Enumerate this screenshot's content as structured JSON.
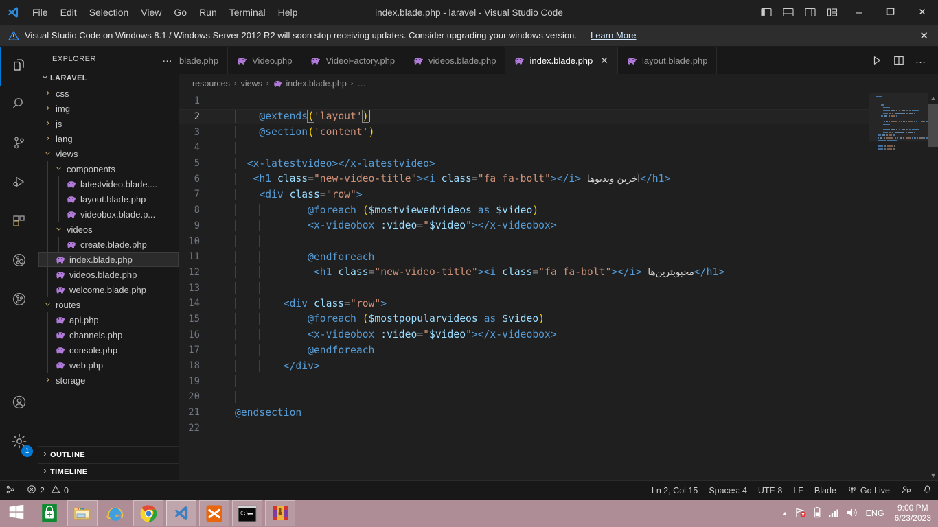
{
  "titlebar": {
    "logo_icon": "vscode-logo",
    "menus": [
      "File",
      "Edit",
      "Selection",
      "View",
      "Go",
      "Run",
      "Terminal",
      "Help"
    ],
    "window_title": "index.blade.php - laravel - Visual Studio Code",
    "layout_buttons": [
      {
        "name": "toggle-primary-sidebar",
        "icon": "panel-left-icon"
      },
      {
        "name": "toggle-panel",
        "icon": "panel-bottom-icon"
      },
      {
        "name": "toggle-secondary-sidebar",
        "icon": "panel-right-icon"
      },
      {
        "name": "customize-layout",
        "icon": "layout-grid-icon"
      }
    ],
    "window_controls": [
      {
        "name": "minimize",
        "glyph": "─"
      },
      {
        "name": "restore",
        "glyph": "❐"
      },
      {
        "name": "close",
        "glyph": "✕"
      }
    ]
  },
  "banner": {
    "icon": "warning-triangle-icon",
    "text": "Visual Studio Code on Windows 8.1 / Windows Server 2012 R2 will soon stop receiving updates. Consider upgrading your windows version.",
    "link": "Learn More",
    "close_glyph": "✕"
  },
  "activitybar": {
    "items": [
      {
        "name": "explorer",
        "icon": "files-icon",
        "active": true
      },
      {
        "name": "search",
        "icon": "search-icon",
        "active": false
      },
      {
        "name": "source-control",
        "icon": "source-control-icon",
        "active": false
      },
      {
        "name": "run-and-debug",
        "icon": "run-debug-icon",
        "active": false
      },
      {
        "name": "extensions",
        "icon": "extensions-icon",
        "active": false
      },
      {
        "name": "git-graph",
        "icon": "git-graph-search-icon",
        "active": false
      },
      {
        "name": "git-history",
        "icon": "git-history-icon",
        "active": false
      }
    ],
    "bottom": [
      {
        "name": "accounts",
        "icon": "account-icon"
      },
      {
        "name": "manage-settings",
        "icon": "gear-icon",
        "badge": "1"
      }
    ]
  },
  "sidebar": {
    "title": "EXPLORER",
    "more_actions": "…",
    "project": "LARAVEL",
    "tree": [
      {
        "label": "css",
        "indent": 1,
        "type": "folder",
        "state": "collapsed"
      },
      {
        "label": "img",
        "indent": 1,
        "type": "folder",
        "state": "collapsed"
      },
      {
        "label": "js",
        "indent": 1,
        "type": "folder",
        "state": "collapsed"
      },
      {
        "label": "lang",
        "indent": 1,
        "type": "folder",
        "state": "collapsed"
      },
      {
        "label": "views",
        "indent": 1,
        "type": "folder",
        "state": "expanded"
      },
      {
        "label": "components",
        "indent": 2,
        "type": "folder",
        "state": "expanded"
      },
      {
        "label": "latestvideo.blade....",
        "indent": 3,
        "type": "php"
      },
      {
        "label": "layout.blade.php",
        "indent": 3,
        "type": "php"
      },
      {
        "label": "videobox.blade.p...",
        "indent": 3,
        "type": "php"
      },
      {
        "label": "videos",
        "indent": 2,
        "type": "folder",
        "state": "expanded"
      },
      {
        "label": "create.blade.php",
        "indent": 3,
        "type": "php"
      },
      {
        "label": "index.blade.php",
        "indent": 2,
        "type": "php",
        "selected": true
      },
      {
        "label": "videos.blade.php",
        "indent": 2,
        "type": "php"
      },
      {
        "label": "welcome.blade.php",
        "indent": 2,
        "type": "php"
      },
      {
        "label": "routes",
        "indent": 1,
        "type": "folder",
        "state": "expanded"
      },
      {
        "label": "api.php",
        "indent": 2,
        "type": "php"
      },
      {
        "label": "channels.php",
        "indent": 2,
        "type": "php"
      },
      {
        "label": "console.php",
        "indent": 2,
        "type": "php"
      },
      {
        "label": "web.php",
        "indent": 2,
        "type": "php"
      },
      {
        "label": "storage",
        "indent": 1,
        "type": "folder",
        "state": "collapsed"
      }
    ],
    "footer_sections": [
      "OUTLINE",
      "TIMELINE"
    ]
  },
  "tabs": [
    {
      "label": "blade.php",
      "icon": "php-icon",
      "active": false,
      "clipped": true
    },
    {
      "label": "Video.php",
      "icon": "php-icon",
      "active": false
    },
    {
      "label": "VideoFactory.php",
      "icon": "php-icon",
      "active": false
    },
    {
      "label": "videos.blade.php",
      "icon": "php-icon",
      "active": false
    },
    {
      "label": "index.blade.php",
      "icon": "php-icon",
      "active": true,
      "close": "✕"
    },
    {
      "label": "layout.blade.php",
      "icon": "php-icon",
      "active": false
    }
  ],
  "tabbar_actions": [
    {
      "name": "run-php-file",
      "icon": "play-icon"
    },
    {
      "name": "split-editor",
      "icon": "split-editor-icon"
    },
    {
      "name": "more-actions",
      "icon": "ellipsis-icon"
    }
  ],
  "breadcrumb": {
    "items": [
      "resources",
      "views",
      "index.blade.php",
      "…"
    ],
    "separator": "›",
    "file_icon": "php-icon"
  },
  "editor": {
    "language_file": "index.blade.php",
    "lines": [
      {
        "n": 1,
        "tokens": []
      },
      {
        "n": 2,
        "current": true,
        "indent_guides": [
          0
        ],
        "tokens": [
          {
            "t": "    ",
            "c": "t-txt"
          },
          {
            "t": "@extends",
            "c": "t-blade"
          },
          {
            "t": "(",
            "c": "t-paren brk"
          },
          {
            "t": "'layout'",
            "c": "t-str"
          },
          {
            "t": ")",
            "c": "t-paren brk"
          }
        ]
      },
      {
        "n": 3,
        "indent_guides": [
          0
        ],
        "tokens": [
          {
            "t": "    ",
            "c": "t-txt"
          },
          {
            "t": "@section",
            "c": "t-blade"
          },
          {
            "t": "(",
            "c": "t-paren"
          },
          {
            "t": "'content'",
            "c": "t-str"
          },
          {
            "t": ")",
            "c": "t-paren"
          }
        ]
      },
      {
        "n": 4,
        "indent_guides": [
          0
        ],
        "tokens": []
      },
      {
        "n": 5,
        "indent_guides": [
          0
        ],
        "tokens": [
          {
            "t": "  ",
            "c": "t-txt"
          },
          {
            "t": "<x-latestvideo>",
            "c": "t-tag"
          },
          {
            "t": "</x-latestvideo>",
            "c": "t-tag"
          }
        ]
      },
      {
        "n": 6,
        "indent_guides": [
          0
        ],
        "tokens": [
          {
            "t": "   ",
            "c": "t-txt"
          },
          {
            "t": "<h1 ",
            "c": "t-tag"
          },
          {
            "t": "class",
            "c": "t-attr"
          },
          {
            "t": "=",
            "c": "t-punct"
          },
          {
            "t": "\"new-video-title\"",
            "c": "t-str"
          },
          {
            "t": ">",
            "c": "t-tag"
          },
          {
            "t": "<i ",
            "c": "t-tag"
          },
          {
            "t": "class",
            "c": "t-attr"
          },
          {
            "t": "=",
            "c": "t-punct"
          },
          {
            "t": "\"fa fa-bolt\"",
            "c": "t-str"
          },
          {
            "t": ">",
            "c": "t-tag"
          },
          {
            "t": "</i>",
            "c": "t-tag"
          },
          {
            "t": " ",
            "c": "t-txt"
          },
          {
            "t": "آخرین ویدیوها",
            "c": "t-rtl"
          },
          {
            "t": "</h1>",
            "c": "t-tag"
          }
        ]
      },
      {
        "n": 7,
        "indent_guides": [
          0
        ],
        "tokens": [
          {
            "t": "    ",
            "c": "t-txt"
          },
          {
            "t": "<div ",
            "c": "t-tag"
          },
          {
            "t": "class",
            "c": "t-attr"
          },
          {
            "t": "=",
            "c": "t-punct"
          },
          {
            "t": "\"row\"",
            "c": "t-str"
          },
          {
            "t": ">",
            "c": "t-tag"
          }
        ]
      },
      {
        "n": 8,
        "indent_guides": [
          0,
          1,
          2,
          3
        ],
        "tokens": [
          {
            "t": "            ",
            "c": "t-txt"
          },
          {
            "t": "@foreach",
            "c": "t-blade"
          },
          {
            "t": " ",
            "c": "t-txt"
          },
          {
            "t": "(",
            "c": "t-paren"
          },
          {
            "t": "$mostviewedvideos",
            "c": "t-var"
          },
          {
            "t": " as ",
            "c": "t-kw"
          },
          {
            "t": "$video",
            "c": "t-var"
          },
          {
            "t": ")",
            "c": "t-paren"
          }
        ]
      },
      {
        "n": 9,
        "indent_guides": [
          0,
          1,
          2,
          3
        ],
        "tokens": [
          {
            "t": "            ",
            "c": "t-txt"
          },
          {
            "t": "<x-videobox ",
            "c": "t-tag"
          },
          {
            "t": ":video",
            "c": "t-attr"
          },
          {
            "t": "=",
            "c": "t-punct"
          },
          {
            "t": "\"",
            "c": "t-str"
          },
          {
            "t": "$video",
            "c": "t-var"
          },
          {
            "t": "\"",
            "c": "t-str"
          },
          {
            "t": ">",
            "c": "t-tag"
          },
          {
            "t": "</x-videobox>",
            "c": "t-tag"
          }
        ]
      },
      {
        "n": 10,
        "indent_guides": [
          0,
          1,
          2,
          3
        ],
        "tokens": []
      },
      {
        "n": 11,
        "indent_guides": [
          0,
          1,
          2,
          3
        ],
        "tokens": [
          {
            "t": "            ",
            "c": "t-txt"
          },
          {
            "t": "@endforeach",
            "c": "t-blade"
          }
        ]
      },
      {
        "n": 12,
        "indent_guides": [
          0,
          1,
          2,
          3,
          4
        ],
        "tokens": [
          {
            "t": "             ",
            "c": "t-txt"
          },
          {
            "t": "<h1 ",
            "c": "t-tag"
          },
          {
            "t": "class",
            "c": "t-attr"
          },
          {
            "t": "=",
            "c": "t-punct"
          },
          {
            "t": "\"new-video-title\"",
            "c": "t-str"
          },
          {
            "t": ">",
            "c": "t-tag"
          },
          {
            "t": "<i ",
            "c": "t-tag"
          },
          {
            "t": "class",
            "c": "t-attr"
          },
          {
            "t": "=",
            "c": "t-punct"
          },
          {
            "t": "\"fa fa-bolt\"",
            "c": "t-str"
          },
          {
            "t": ">",
            "c": "t-tag"
          },
          {
            "t": "</i>",
            "c": "t-tag"
          },
          {
            "t": " ",
            "c": "t-txt"
          },
          {
            "t": "محبوبترین‌ها",
            "c": "t-rtl"
          },
          {
            "t": "</h1>",
            "c": "t-tag"
          }
        ]
      },
      {
        "n": 13,
        "indent_guides": [
          0,
          1,
          2,
          3
        ],
        "tokens": []
      },
      {
        "n": 14,
        "indent_guides": [
          0,
          1,
          2
        ],
        "tokens": [
          {
            "t": "        ",
            "c": "t-txt"
          },
          {
            "t": "<div ",
            "c": "t-tag"
          },
          {
            "t": "class",
            "c": "t-attr"
          },
          {
            "t": "=",
            "c": "t-punct"
          },
          {
            "t": "\"row\"",
            "c": "t-str"
          },
          {
            "t": ">",
            "c": "t-tag"
          }
        ]
      },
      {
        "n": 15,
        "indent_guides": [
          0,
          1,
          2,
          3
        ],
        "tokens": [
          {
            "t": "            ",
            "c": "t-txt"
          },
          {
            "t": "@foreach",
            "c": "t-blade"
          },
          {
            "t": " ",
            "c": "t-txt"
          },
          {
            "t": "(",
            "c": "t-paren"
          },
          {
            "t": "$mostpopularvideos",
            "c": "t-var"
          },
          {
            "t": " as ",
            "c": "t-kw"
          },
          {
            "t": "$video",
            "c": "t-var"
          },
          {
            "t": ")",
            "c": "t-paren"
          }
        ]
      },
      {
        "n": 16,
        "indent_guides": [
          0,
          1,
          2,
          3
        ],
        "tokens": [
          {
            "t": "            ",
            "c": "t-txt"
          },
          {
            "t": "<x-videobox ",
            "c": "t-tag"
          },
          {
            "t": ":video",
            "c": "t-attr"
          },
          {
            "t": "=",
            "c": "t-punct"
          },
          {
            "t": "\"",
            "c": "t-str"
          },
          {
            "t": "$video",
            "c": "t-var"
          },
          {
            "t": "\"",
            "c": "t-str"
          },
          {
            "t": ">",
            "c": "t-tag"
          },
          {
            "t": "</x-videobox>",
            "c": "t-tag"
          }
        ]
      },
      {
        "n": 17,
        "indent_guides": [
          0,
          1,
          2,
          3
        ],
        "tokens": [
          {
            "t": "            ",
            "c": "t-txt"
          },
          {
            "t": "@endforeach",
            "c": "t-blade"
          }
        ]
      },
      {
        "n": 18,
        "indent_guides": [
          0,
          1,
          2
        ],
        "tokens": [
          {
            "t": "        ",
            "c": "t-txt"
          },
          {
            "t": "</div>",
            "c": "t-tag"
          }
        ]
      },
      {
        "n": 19,
        "indent_guides": [
          0
        ],
        "tokens": []
      },
      {
        "n": 20,
        "indent_guides": [
          0
        ],
        "tokens": []
      },
      {
        "n": 21,
        "indent_guides": [],
        "tokens": [
          {
            "t": "@endsection",
            "c": "t-blade"
          }
        ]
      },
      {
        "n": 22,
        "tokens": []
      }
    ]
  },
  "statusbar": {
    "left": [
      {
        "name": "remote-indicator",
        "icon": "remote-icon"
      },
      {
        "name": "problems",
        "icon": "error-warning",
        "errors": "2",
        "warnings": "0"
      }
    ],
    "right": [
      {
        "name": "editor-position",
        "label": "Ln 2, Col 15"
      },
      {
        "name": "editor-indentation",
        "label": "Spaces: 4"
      },
      {
        "name": "editor-encoding",
        "label": "UTF-8"
      },
      {
        "name": "editor-eol",
        "label": "LF"
      },
      {
        "name": "editor-language",
        "label": "Blade"
      },
      {
        "name": "go-live",
        "label": "Go Live",
        "icon": "broadcast-icon"
      },
      {
        "name": "live-share",
        "icon": "live-share-icon"
      },
      {
        "name": "notifications",
        "icon": "bell-icon"
      }
    ]
  },
  "taskbar": {
    "start_icon": "windows-logo-icon",
    "items": [
      {
        "name": "store",
        "icon": "store-icon"
      },
      {
        "name": "file-explorer",
        "icon": "folder-icon",
        "framed": true
      },
      {
        "name": "internet-explorer",
        "icon": "ie-icon"
      },
      {
        "name": "google-chrome",
        "icon": "chrome-icon",
        "framed": true
      },
      {
        "name": "visual-studio-code",
        "icon": "vscode-icon",
        "running": true
      },
      {
        "name": "xampp",
        "icon": "xampp-icon",
        "framed": true
      },
      {
        "name": "command-prompt",
        "icon": "cmd-icon",
        "framed": true
      },
      {
        "name": "winrar",
        "icon": "winrar-icon",
        "framed": true
      }
    ],
    "tray": {
      "show_hidden": "▲",
      "network_icon": "network-error-icon",
      "battery_icon": "battery-icon",
      "signal_icon": "signal-icon",
      "volume_icon": "volume-icon",
      "language": "ENG",
      "time": "9:00 PM",
      "date": "6/23/2023"
    }
  },
  "colors": {
    "accent": "#0078d4",
    "editor_bg": "#1f1f1f",
    "sidebar_bg": "#181818",
    "taskbar_bg": "#ae8d96",
    "blade_token": "#569cd6",
    "string_token": "#ce9178",
    "attr_token": "#9cdcfe"
  }
}
